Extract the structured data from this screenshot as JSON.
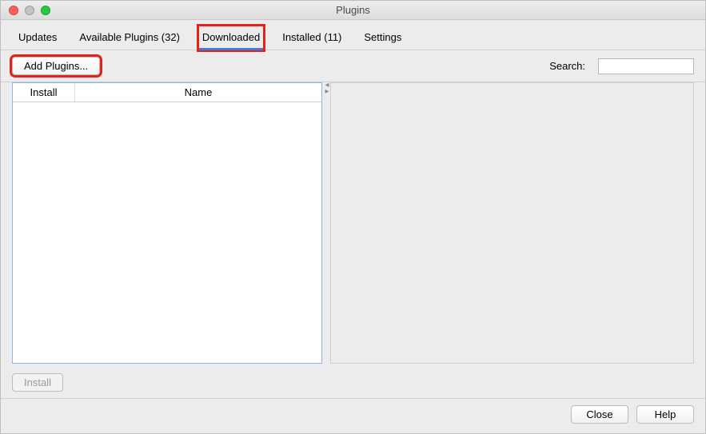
{
  "window": {
    "title": "Plugins"
  },
  "tabs": {
    "updates": "Updates",
    "available": "Available Plugins (32)",
    "downloaded": "Downloaded",
    "installed": "Installed (11)",
    "settings": "Settings",
    "active": "downloaded"
  },
  "toolbar": {
    "add_plugins": "Add Plugins...",
    "search_label": "Search:",
    "search_value": ""
  },
  "table": {
    "col_install": "Install",
    "col_name": "Name",
    "rows": []
  },
  "actions": {
    "install": "Install",
    "close": "Close",
    "help": "Help"
  }
}
